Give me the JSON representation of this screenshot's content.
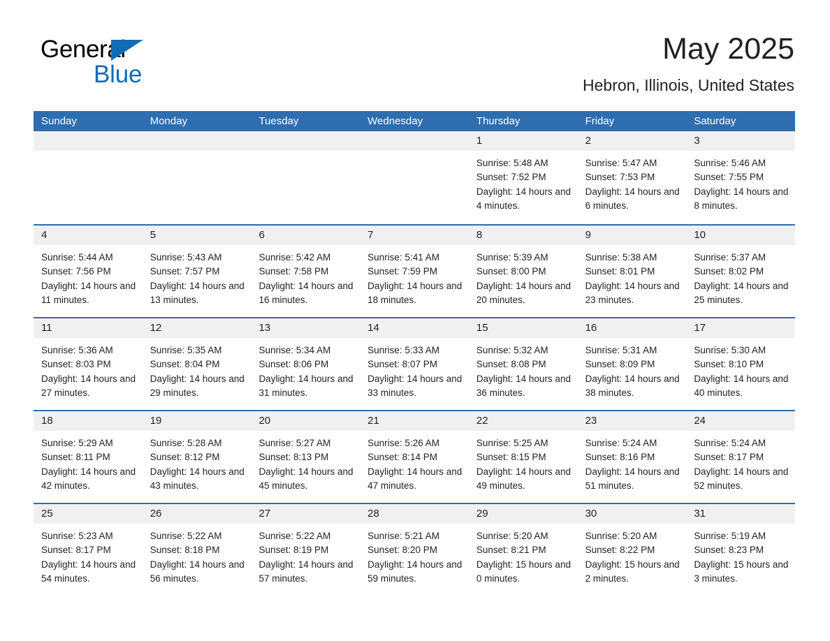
{
  "logo": {
    "word1": "General",
    "word2": "Blue",
    "triangle_color": "#0f6cb5",
    "icon": "general-blue-triangle-icon"
  },
  "header": {
    "title": "May 2025",
    "subtitle": "Hebron, Illinois, United States"
  },
  "theme": {
    "header_blue": "#2e6daf",
    "day_band_gray": "#f0f0f0",
    "text": "#231f20",
    "logo_blue": "#0f6cb5"
  },
  "weekdays": [
    "Sunday",
    "Monday",
    "Tuesday",
    "Wednesday",
    "Thursday",
    "Friday",
    "Saturday"
  ],
  "weeks": [
    [
      {
        "day": "",
        "sunrise": "",
        "sunset": "",
        "daylight": "",
        "empty": true
      },
      {
        "day": "",
        "sunrise": "",
        "sunset": "",
        "daylight": "",
        "empty": true
      },
      {
        "day": "",
        "sunrise": "",
        "sunset": "",
        "daylight": "",
        "empty": true
      },
      {
        "day": "",
        "sunrise": "",
        "sunset": "",
        "daylight": "",
        "empty": true
      },
      {
        "day": "1",
        "sunrise": "Sunrise: 5:48 AM",
        "sunset": "Sunset: 7:52 PM",
        "daylight": "Daylight: 14 hours and 4 minutes."
      },
      {
        "day": "2",
        "sunrise": "Sunrise: 5:47 AM",
        "sunset": "Sunset: 7:53 PM",
        "daylight": "Daylight: 14 hours and 6 minutes."
      },
      {
        "day": "3",
        "sunrise": "Sunrise: 5:46 AM",
        "sunset": "Sunset: 7:55 PM",
        "daylight": "Daylight: 14 hours and 8 minutes."
      }
    ],
    [
      {
        "day": "4",
        "sunrise": "Sunrise: 5:44 AM",
        "sunset": "Sunset: 7:56 PM",
        "daylight": "Daylight: 14 hours and 11 minutes."
      },
      {
        "day": "5",
        "sunrise": "Sunrise: 5:43 AM",
        "sunset": "Sunset: 7:57 PM",
        "daylight": "Daylight: 14 hours and 13 minutes."
      },
      {
        "day": "6",
        "sunrise": "Sunrise: 5:42 AM",
        "sunset": "Sunset: 7:58 PM",
        "daylight": "Daylight: 14 hours and 16 minutes."
      },
      {
        "day": "7",
        "sunrise": "Sunrise: 5:41 AM",
        "sunset": "Sunset: 7:59 PM",
        "daylight": "Daylight: 14 hours and 18 minutes."
      },
      {
        "day": "8",
        "sunrise": "Sunrise: 5:39 AM",
        "sunset": "Sunset: 8:00 PM",
        "daylight": "Daylight: 14 hours and 20 minutes."
      },
      {
        "day": "9",
        "sunrise": "Sunrise: 5:38 AM",
        "sunset": "Sunset: 8:01 PM",
        "daylight": "Daylight: 14 hours and 23 minutes."
      },
      {
        "day": "10",
        "sunrise": "Sunrise: 5:37 AM",
        "sunset": "Sunset: 8:02 PM",
        "daylight": "Daylight: 14 hours and 25 minutes."
      }
    ],
    [
      {
        "day": "11",
        "sunrise": "Sunrise: 5:36 AM",
        "sunset": "Sunset: 8:03 PM",
        "daylight": "Daylight: 14 hours and 27 minutes."
      },
      {
        "day": "12",
        "sunrise": "Sunrise: 5:35 AM",
        "sunset": "Sunset: 8:04 PM",
        "daylight": "Daylight: 14 hours and 29 minutes."
      },
      {
        "day": "13",
        "sunrise": "Sunrise: 5:34 AM",
        "sunset": "Sunset: 8:06 PM",
        "daylight": "Daylight: 14 hours and 31 minutes."
      },
      {
        "day": "14",
        "sunrise": "Sunrise: 5:33 AM",
        "sunset": "Sunset: 8:07 PM",
        "daylight": "Daylight: 14 hours and 33 minutes."
      },
      {
        "day": "15",
        "sunrise": "Sunrise: 5:32 AM",
        "sunset": "Sunset: 8:08 PM",
        "daylight": "Daylight: 14 hours and 36 minutes."
      },
      {
        "day": "16",
        "sunrise": "Sunrise: 5:31 AM",
        "sunset": "Sunset: 8:09 PM",
        "daylight": "Daylight: 14 hours and 38 minutes."
      },
      {
        "day": "17",
        "sunrise": "Sunrise: 5:30 AM",
        "sunset": "Sunset: 8:10 PM",
        "daylight": "Daylight: 14 hours and 40 minutes."
      }
    ],
    [
      {
        "day": "18",
        "sunrise": "Sunrise: 5:29 AM",
        "sunset": "Sunset: 8:11 PM",
        "daylight": "Daylight: 14 hours and 42 minutes."
      },
      {
        "day": "19",
        "sunrise": "Sunrise: 5:28 AM",
        "sunset": "Sunset: 8:12 PM",
        "daylight": "Daylight: 14 hours and 43 minutes."
      },
      {
        "day": "20",
        "sunrise": "Sunrise: 5:27 AM",
        "sunset": "Sunset: 8:13 PM",
        "daylight": "Daylight: 14 hours and 45 minutes."
      },
      {
        "day": "21",
        "sunrise": "Sunrise: 5:26 AM",
        "sunset": "Sunset: 8:14 PM",
        "daylight": "Daylight: 14 hours and 47 minutes."
      },
      {
        "day": "22",
        "sunrise": "Sunrise: 5:25 AM",
        "sunset": "Sunset: 8:15 PM",
        "daylight": "Daylight: 14 hours and 49 minutes."
      },
      {
        "day": "23",
        "sunrise": "Sunrise: 5:24 AM",
        "sunset": "Sunset: 8:16 PM",
        "daylight": "Daylight: 14 hours and 51 minutes."
      },
      {
        "day": "24",
        "sunrise": "Sunrise: 5:24 AM",
        "sunset": "Sunset: 8:17 PM",
        "daylight": "Daylight: 14 hours and 52 minutes."
      }
    ],
    [
      {
        "day": "25",
        "sunrise": "Sunrise: 5:23 AM",
        "sunset": "Sunset: 8:17 PM",
        "daylight": "Daylight: 14 hours and 54 minutes."
      },
      {
        "day": "26",
        "sunrise": "Sunrise: 5:22 AM",
        "sunset": "Sunset: 8:18 PM",
        "daylight": "Daylight: 14 hours and 56 minutes."
      },
      {
        "day": "27",
        "sunrise": "Sunrise: 5:22 AM",
        "sunset": "Sunset: 8:19 PM",
        "daylight": "Daylight: 14 hours and 57 minutes."
      },
      {
        "day": "28",
        "sunrise": "Sunrise: 5:21 AM",
        "sunset": "Sunset: 8:20 PM",
        "daylight": "Daylight: 14 hours and 59 minutes."
      },
      {
        "day": "29",
        "sunrise": "Sunrise: 5:20 AM",
        "sunset": "Sunset: 8:21 PM",
        "daylight": "Daylight: 15 hours and 0 minutes."
      },
      {
        "day": "30",
        "sunrise": "Sunrise: 5:20 AM",
        "sunset": "Sunset: 8:22 PM",
        "daylight": "Daylight: 15 hours and 2 minutes."
      },
      {
        "day": "31",
        "sunrise": "Sunrise: 5:19 AM",
        "sunset": "Sunset: 8:23 PM",
        "daylight": "Daylight: 15 hours and 3 minutes."
      }
    ]
  ]
}
